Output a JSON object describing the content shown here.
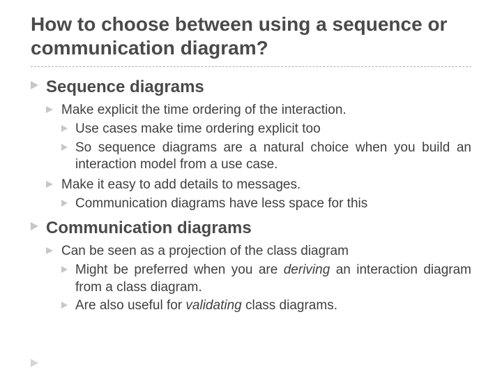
{
  "title": "How to choose between using a sequence or communication diagram?",
  "sections": [
    {
      "heading": "Sequence diagrams",
      "items": [
        {
          "text": "Make explicit the time ordering of the interaction.",
          "justify": false,
          "sub": [
            {
              "text": "Use cases make time ordering explicit too",
              "justify": false
            },
            {
              "text": "So sequence diagrams are a natural choice when you build an interaction model from a use case.",
              "justify": true
            }
          ]
        },
        {
          "text": "Make it easy to add details to messages.",
          "justify": false,
          "sub": [
            {
              "text": "Communication diagrams have less space for this",
              "justify": false
            }
          ]
        }
      ]
    },
    {
      "heading": "Communication diagrams",
      "items": [
        {
          "text": "Can be seen as a projection of the class diagram",
          "justify": false,
          "sub": [
            {
              "html": "Might be preferred when you are <span class=\"italic\">deriving</span> an interaction diagram from a class diagram.",
              "justify": true
            },
            {
              "html": "Are also useful for <span class=\"italic\">validating</span> class diagrams.",
              "justify": false
            }
          ]
        }
      ]
    }
  ]
}
